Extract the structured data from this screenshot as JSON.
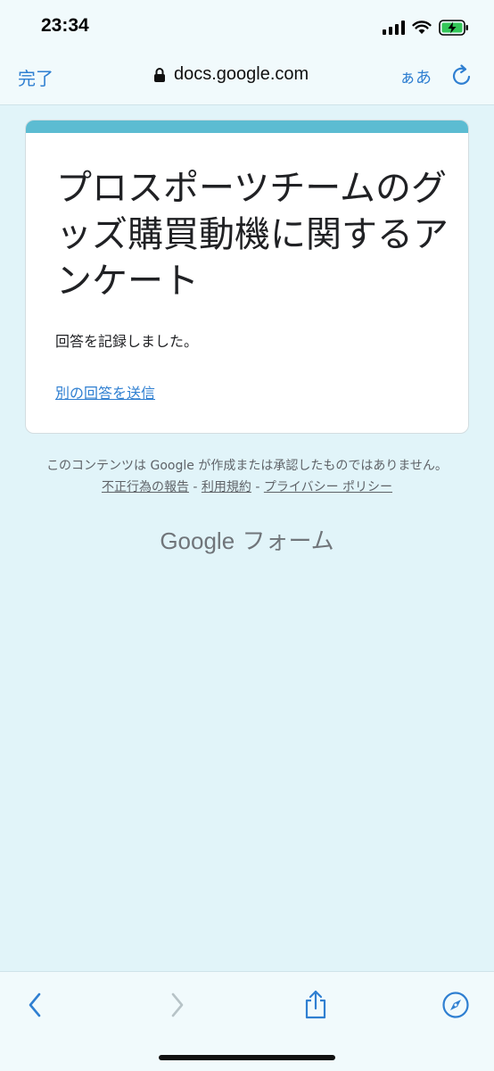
{
  "status_bar": {
    "time": "23:34"
  },
  "url_bar": {
    "done_label": "完了",
    "url": "docs.google.com",
    "text_size_label": "ぁあ"
  },
  "form": {
    "title": "プロスポーツチームのグッズ購買動機に関するアンケート",
    "message": "回答を記録しました。",
    "resubmit_link": "別の回答を送信"
  },
  "footer": {
    "disclaimer": "このコンテンツは Google が作成または承認したものではありません。",
    "report_link": "不正行為の報告",
    "terms_link": "利用規約",
    "privacy_link": "プライバシー ポリシー",
    "separator": " - ",
    "brand_google": "Google",
    "brand_forms": "フォーム"
  },
  "colors": {
    "accent": "#5cbcd2",
    "link": "#2f7fd1",
    "background": "#e1f4f9"
  },
  "icons": {
    "lock": "lock-icon",
    "reload": "reload-icon",
    "back": "chevron-left-icon",
    "forward": "chevron-right-icon",
    "share": "share-icon",
    "compass": "compass-icon"
  }
}
